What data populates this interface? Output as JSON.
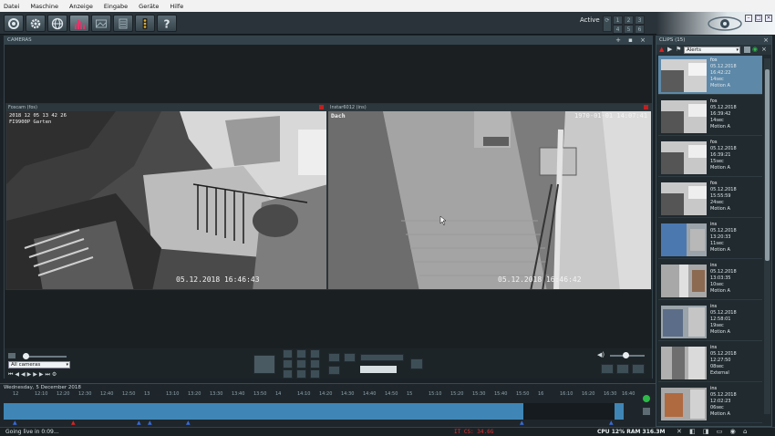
{
  "menu": [
    "Datei",
    "Maschine",
    "Anzeige",
    "Eingabe",
    "Geräte",
    "Hilfe"
  ],
  "toolbar": {
    "status": "Active",
    "grid_buttons": [
      "1",
      "2",
      "3",
      "4",
      "5",
      "6"
    ]
  },
  "cameras_panel": {
    "title": "CAMERAS",
    "cam1": {
      "title": "Foscam (fos)",
      "osd_top1": "2018 12 05 13 42 26",
      "osd_top2": "FI9900P Garten",
      "osd_bottom": "05.12.2018  16:46:43"
    },
    "cam2": {
      "title": "Instar6012 (ins)",
      "osd_name": "Dach",
      "osd_top": "1970-01-01 14:07:41",
      "osd_bottom": "05.12.2018  16:46:42"
    },
    "camera_filter": "All cameras"
  },
  "timeline": {
    "date": "Wednesday, 5 December 2018",
    "ticks": [
      "12",
      "12:10",
      "12:20",
      "12:30",
      "12:40",
      "12:50",
      "13",
      "13:10",
      "13:20",
      "13:30",
      "13:40",
      "13:50",
      "14",
      "14:10",
      "14:20",
      "14:30",
      "14:40",
      "14:50",
      "15",
      "15:10",
      "15:20",
      "15:30",
      "15:40",
      "15:50",
      "16",
      "16:10",
      "16:20",
      "16:30",
      "16:40"
    ]
  },
  "status": {
    "left": "Going live in 0:09...",
    "mid": "IT CS: 34.6G",
    "right": "CPU 12% RAM 316.3M"
  },
  "clips": {
    "title": "CLIPS (15)",
    "filter": "Alerts",
    "items": [
      {
        "src": "fos",
        "date": "05.12.2018",
        "time": "16:42:22",
        "dur": "14sec",
        "type": "Motion A"
      },
      {
        "src": "fos",
        "date": "05.12.2018",
        "time": "16:39:42",
        "dur": "14sec",
        "type": "Motion A"
      },
      {
        "src": "fos",
        "date": "05.12.2018",
        "time": "16:39:21",
        "dur": "15sec",
        "type": "Motion A"
      },
      {
        "src": "fos",
        "date": "05.12.2018",
        "time": "15:55:59",
        "dur": "24sec",
        "type": "Motion A"
      },
      {
        "src": "ins",
        "date": "05.12.2018",
        "time": "13:20:33",
        "dur": "11sec",
        "type": "Motion A"
      },
      {
        "src": "ins",
        "date": "05.12.2018",
        "time": "13:03:35",
        "dur": "10sec",
        "type": "Motion A"
      },
      {
        "src": "ins",
        "date": "05.12.2018",
        "time": "12:58:01",
        "dur": "19sec",
        "type": "Motion A"
      },
      {
        "src": "ins",
        "date": "05.12.2018",
        "time": "12:27:50",
        "dur": "08sec",
        "type": "External"
      },
      {
        "src": "ins",
        "date": "05.12.2018",
        "time": "12:02:23",
        "dur": "06sec",
        "type": "Motion A"
      }
    ]
  },
  "colors": {
    "accent": "#3f86b6",
    "selected": "#5d88a8",
    "alert": "#d22222"
  }
}
